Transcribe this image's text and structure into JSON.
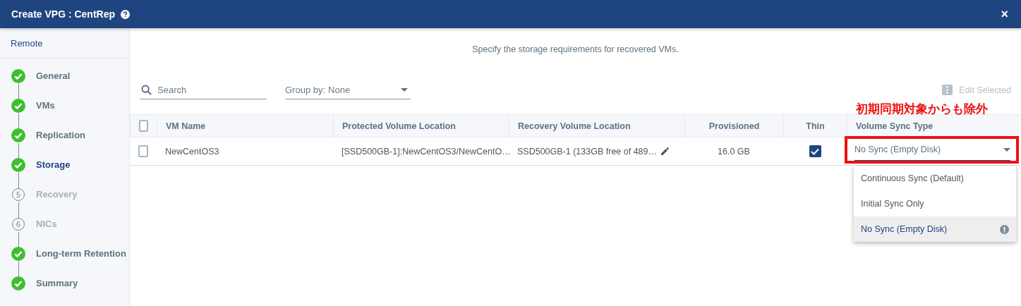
{
  "window": {
    "title": "Create VPG : CentRep",
    "close": "×"
  },
  "sidebar": {
    "section": "Remote",
    "steps": [
      {
        "label": "General",
        "done": true,
        "selected": false
      },
      {
        "label": "VMs",
        "done": true,
        "selected": false
      },
      {
        "label": "Replication",
        "done": true,
        "selected": false
      },
      {
        "label": "Storage",
        "done": true,
        "selected": true
      },
      {
        "label": "Recovery",
        "done": false,
        "number": "5",
        "selected": false
      },
      {
        "label": "NICs",
        "done": false,
        "number": "6",
        "selected": false
      },
      {
        "label": "Long-term Retention",
        "done": true,
        "selected": false
      },
      {
        "label": "Summary",
        "done": true,
        "selected": false
      }
    ]
  },
  "description": "Specify the storage requirements for recovered VMs.",
  "toolbar": {
    "search": {
      "placeholder": "Search"
    },
    "group_by": {
      "label": "Group by:",
      "value": "None"
    },
    "edit_selected": {
      "label": "Edit Selected",
      "disabled": true
    }
  },
  "table": {
    "columns": [
      "VM Name",
      "Protected Volume Location",
      "Recovery Volume Location",
      "Provisioned",
      "Thin",
      "Volume Sync Type"
    ],
    "all_checked": false,
    "rows": [
      {
        "checked": false,
        "vm_name": "NewCentOS3",
        "protected_location": "[SSD500GB-1]:NewCentOS3/NewCentO…",
        "recovery_location": "SSD500GB-1 (133GB free of 489…",
        "provisioned": "16.0 GB",
        "thin": true,
        "sync_type": "No Sync (Empty Disk)"
      }
    ]
  },
  "sync_menu": [
    {
      "label": "Continuous Sync (Default)",
      "selected": false,
      "warning": false
    },
    {
      "label": "Initial Sync Only",
      "selected": false,
      "warning": false
    },
    {
      "label": "No Sync (Empty Disk)",
      "selected": true,
      "warning": true
    }
  ],
  "annotation": {
    "text": "初期同期対象からも除外",
    "color": "#ee1111"
  }
}
